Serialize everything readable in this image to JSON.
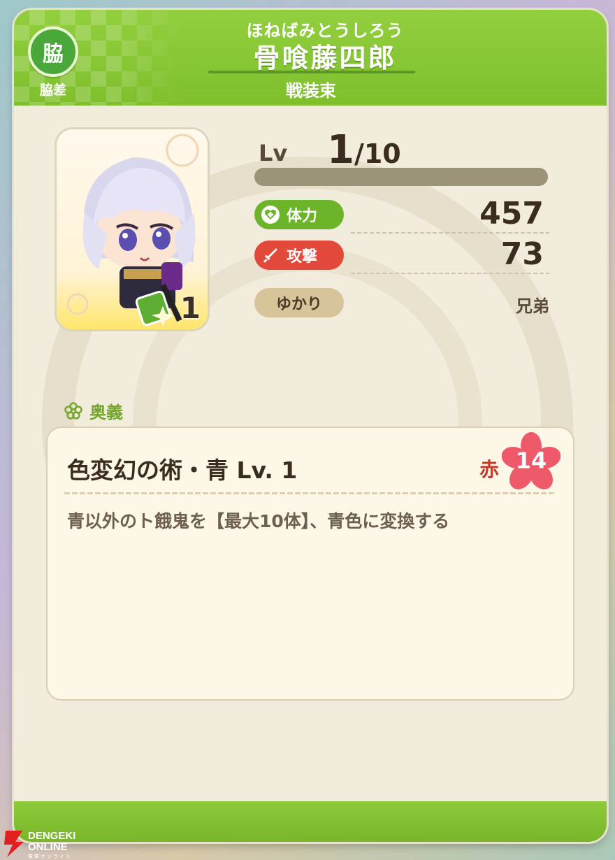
{
  "header": {
    "type_badge_char": "脇",
    "type_label": "脇差",
    "furigana": "ほねばみとうしろう",
    "name": "骨喰藤四郎",
    "costume": "戦装束"
  },
  "portrait": {
    "stack_count": "1"
  },
  "level": {
    "label": "Lv",
    "current": "1",
    "max": "10",
    "progress": 0.0
  },
  "stats": {
    "hp_label": "体力",
    "hp_value": "457",
    "atk_label": "攻撃",
    "atk_value": "73",
    "yukari_label": "ゆかり",
    "yukari_value": "兄弟"
  },
  "ougi": {
    "section_title": "奥義",
    "skill_name": "色変幻の術・青 Lv. 1",
    "color_label": "赤",
    "cost": "14",
    "description": "青以外のト餓鬼を【最大10体】、青色に変換する"
  },
  "watermark": {
    "logo_line1": "DENGEKI",
    "logo_line2": "ONLINE",
    "sub": "電撃オンライン"
  },
  "colors": {
    "header_green": "#7fbf2c",
    "hp_green": "#6cb52b",
    "atk_red": "#e2493a",
    "panel_bg": "#f2ecdc"
  }
}
